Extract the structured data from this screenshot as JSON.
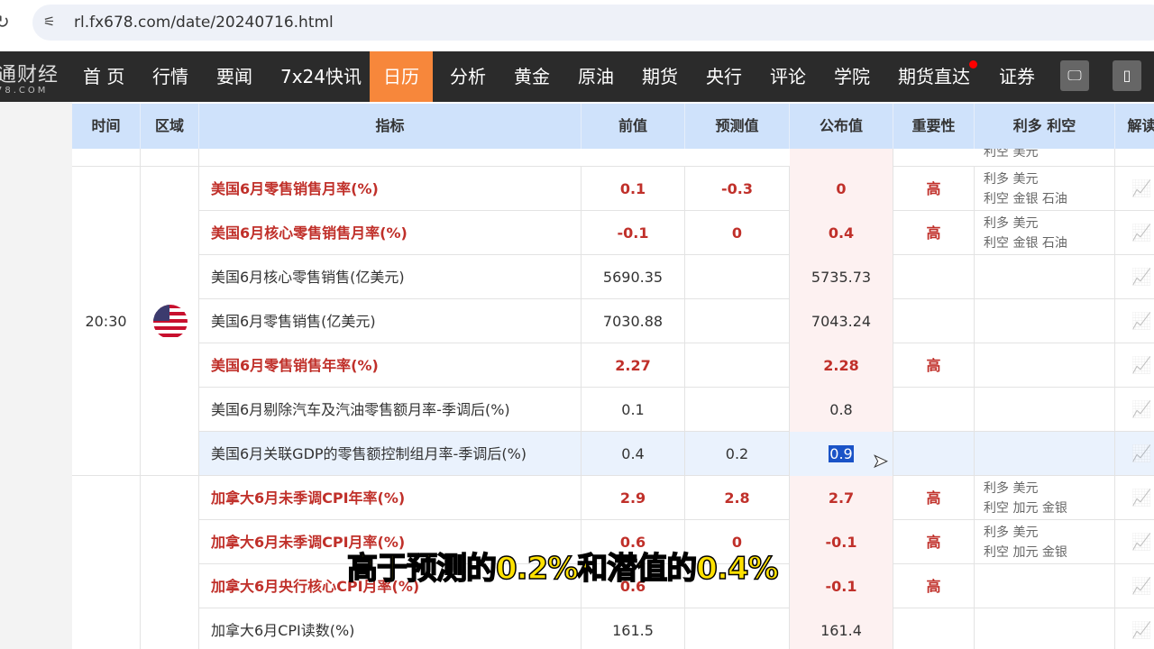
{
  "browser": {
    "url": "rl.fx678.com/date/20240716.html"
  },
  "nav": {
    "logo": "通财经",
    "logo_sub": "78.COM",
    "items": [
      "首 页",
      "行情",
      "要闻",
      "7x24快讯",
      "日历",
      "分析",
      "黄金",
      "原油",
      "期货",
      "央行",
      "评论",
      "学院",
      "期货直达",
      "证券"
    ],
    "active": "日历"
  },
  "table": {
    "headers": [
      "时间",
      "区域",
      "指标",
      "前值",
      "预测值",
      "公布值",
      "重要性",
      "利多 利空",
      "解读"
    ],
    "partial_row": {
      "effect": "利空  美元"
    },
    "group1": {
      "time": "20:30",
      "region": "美国"
    },
    "rows": [
      {
        "name": "美国6月零售销售月率(%)",
        "prev": "0.1",
        "fore": "-0.3",
        "pub": "0",
        "imp": "高",
        "e1": "利多  美元",
        "e2": "利空  金银 石油",
        "red": true
      },
      {
        "name": "美国6月核心零售销售月率(%)",
        "prev": "-0.1",
        "fore": "0",
        "pub": "0.4",
        "imp": "高",
        "e1": "利多  美元",
        "e2": "利空  金银 石油",
        "red": true
      },
      {
        "name": "美国6月核心零售销售(亿美元)",
        "prev": "5690.35",
        "fore": "",
        "pub": "5735.73",
        "imp": "",
        "e1": "",
        "e2": "",
        "red": false
      },
      {
        "name": "美国6月零售销售(亿美元)",
        "prev": "7030.88",
        "fore": "",
        "pub": "7043.24",
        "imp": "",
        "e1": "",
        "e2": "",
        "red": false
      },
      {
        "name": "美国6月零售销售年率(%)",
        "prev": "2.27",
        "fore": "",
        "pub": "2.28",
        "imp": "高",
        "e1": "",
        "e2": "",
        "red": true
      },
      {
        "name": "美国6月剔除汽车及汽油零售额月率-季调后(%)",
        "prev": "0.1",
        "fore": "",
        "pub": "0.8",
        "imp": "",
        "e1": "",
        "e2": "",
        "red": false
      },
      {
        "name": "美国6月关联GDP的零售额控制组月率-季调后(%)",
        "prev": "0.4",
        "fore": "0.2",
        "pub": "0.9",
        "imp": "",
        "e1": "",
        "e2": "",
        "red": false
      },
      {
        "name": "加拿大6月未季调CPI年率(%)",
        "prev": "2.9",
        "fore": "2.8",
        "pub": "2.7",
        "imp": "高",
        "e1": "利多  美元",
        "e2": "利空  加元 金银",
        "red": true
      },
      {
        "name": "加拿大6月未季调CPI月率(%)",
        "prev": "0.6",
        "fore": "0",
        "pub": "-0.1",
        "imp": "高",
        "e1": "利多  美元",
        "e2": "利空  加元 金银",
        "red": true
      },
      {
        "name": "加拿大6月央行核心CPI月率(%)",
        "prev": "0.6",
        "fore": "",
        "pub": "-0.1",
        "imp": "高",
        "e1": "",
        "e2": "",
        "red": true
      },
      {
        "name": "加拿大6月CPI读数(%)",
        "prev": "161.5",
        "fore": "",
        "pub": "161.4",
        "imp": "",
        "e1": "",
        "e2": "",
        "red": false
      }
    ]
  },
  "subtitle": "高于预测的0.2%和潜值的0.4%"
}
